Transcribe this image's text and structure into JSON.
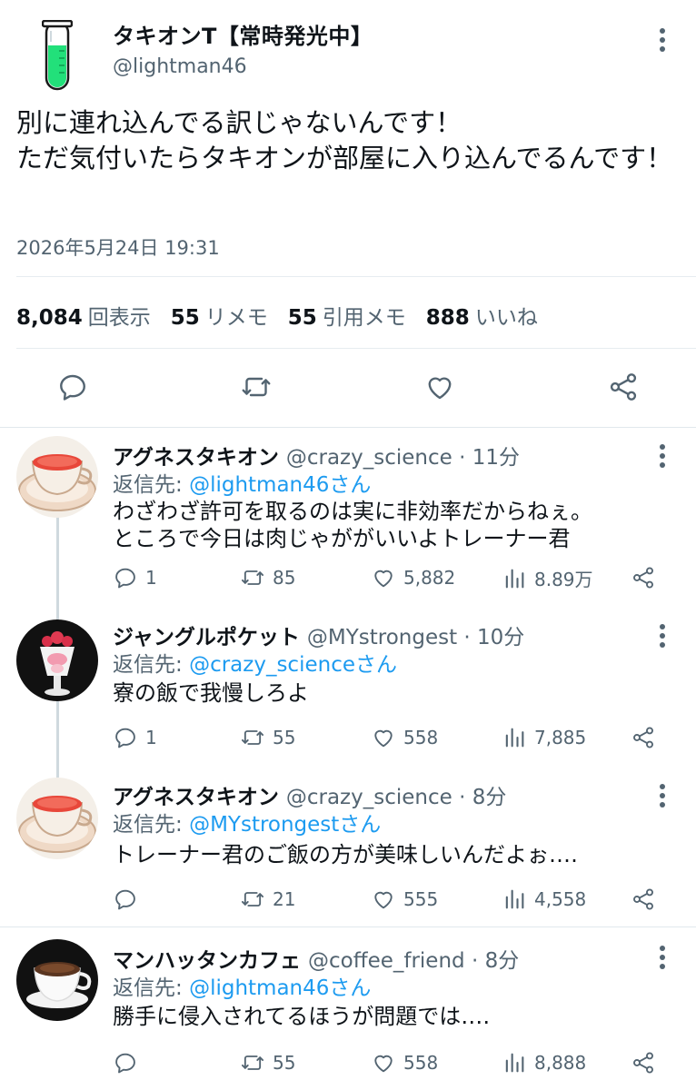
{
  "main_tweet": {
    "display_name": "タキオンT【常時発光中】",
    "handle": "@lightman46",
    "text": "別に連れ込んでる訳じゃないんです！\nただ気付いたらタキオンが部屋に入り込んでるんです！",
    "timestamp": "2026年5月24日 19:31",
    "stats": {
      "views_num": "8,084",
      "views_label": "回表示",
      "retweets_num": "55",
      "retweets_label": "リメモ",
      "quotes_num": "55",
      "quotes_label": "引用メモ",
      "likes_num": "888",
      "likes_label": "いいね"
    }
  },
  "replies": [
    {
      "name": "アグネスタキオン",
      "handle_time": "@crazy_science · 11分",
      "replying_label": "返信先:",
      "replying_to": "@lightman46さん",
      "text": "わざわざ許可を取るのは実に非効率だからねぇ。\nところで今日は肉じゃががいいよトレーナー君",
      "replies": "1",
      "retweets": "85",
      "likes": "5,882",
      "views": "8.89万",
      "avatar": "tea-cup-red"
    },
    {
      "name": "ジャングルポケット",
      "handle_time": "@MYstrongest · 10分",
      "replying_label": "返信先:",
      "replying_to": "@crazy_scienceさん",
      "text": "寮の飯で我慢しろよ",
      "replies": "1",
      "retweets": "55",
      "likes": "558",
      "views": "7,885",
      "avatar": "parfait"
    },
    {
      "name": "アグネスタキオン",
      "handle_time": "@crazy_science · 8分",
      "replying_label": "返信先:",
      "replying_to": "@MYstrongestさん",
      "text": "トレーナー君のご飯の方が美味しいんだよぉ‥‥",
      "replies": "",
      "retweets": "21",
      "likes": "555",
      "views": "4,558",
      "avatar": "tea-cup-red"
    },
    {
      "name": "マンハッタンカフェ",
      "handle_time": "@coffee_friend · 8分",
      "replying_label": "返信先:",
      "replying_to": "@lightman46さん",
      "text": "勝手に侵入されてるほうが問題では‥‥",
      "replies": "",
      "retweets": "55",
      "likes": "558",
      "views": "8,888",
      "avatar": "coffee-cup"
    }
  ],
  "colors": {
    "text": "#0f1419",
    "secondary": "#536471",
    "link": "#1d9bf0",
    "divider": "#e1e8ed",
    "thread_line": "#cfd9de"
  }
}
